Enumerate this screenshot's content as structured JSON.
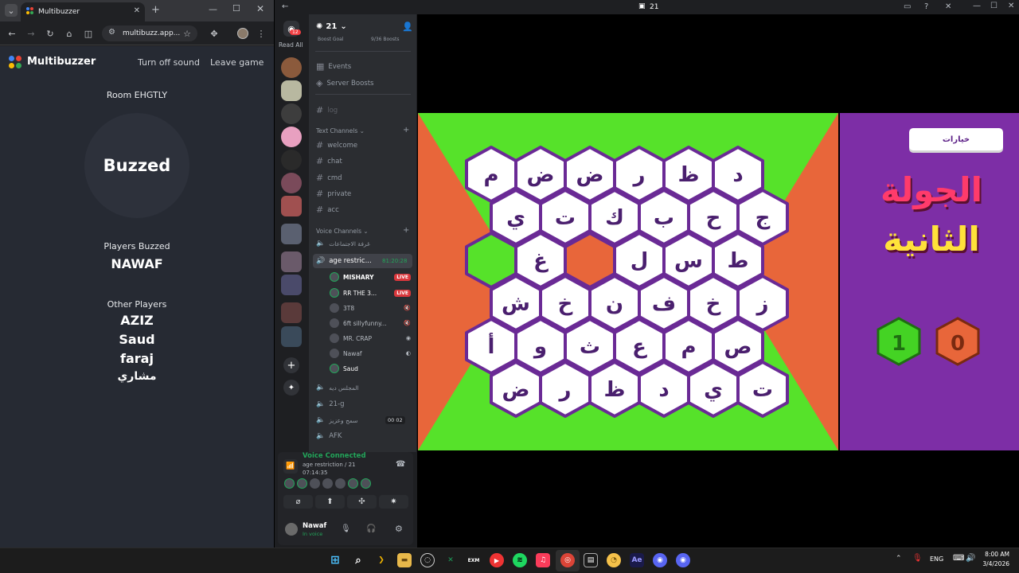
{
  "browser": {
    "tab_title": "Multibuzzer",
    "url": "multibuzz.app...",
    "brand_color": "#4285f4"
  },
  "multibuzzer": {
    "app_name": "Multibuzzer",
    "turn_off_sound": "Turn off sound",
    "leave_game": "Leave game",
    "room": "Room EHGTLY",
    "buzz_label": "Buzzed",
    "players_buzzed_heading": "Players Buzzed",
    "buzzed_players": [
      "NAWAF"
    ],
    "other_players_heading": "Other Players",
    "other_players": [
      "AZIZ",
      "Saud",
      "faraj",
      "مشاري"
    ]
  },
  "discord": {
    "title": "21",
    "server_name": "21",
    "read_all": "Read All",
    "mention_badge": "12",
    "boost_goal": "Boost Goal",
    "boost_count": "9/36 Boosts",
    "top_items": [
      "Events",
      "Server Boosts"
    ],
    "log_channel": "log",
    "text_category": "Text Channels",
    "text_channels": [
      "welcome",
      "chat",
      "cmd",
      "private",
      "acc"
    ],
    "voice_category": "Voice Channels",
    "voice_channels_top": [
      "غرفة الاجتماعات"
    ],
    "active_voice": {
      "name": "age restric...",
      "timer": "81:20:28"
    },
    "voice_users": [
      {
        "name": "MISHARY",
        "live": "LIVE"
      },
      {
        "name": "RR THE 3...",
        "live": "LIVE"
      },
      {
        "name": "3T8",
        "live": ""
      },
      {
        "name": "6ft sillyfunny...",
        "live": ""
      },
      {
        "name": "MR. CRAP",
        "live": ""
      },
      {
        "name": "Nawaf",
        "live": ""
      },
      {
        "name": "Saud",
        "live": ""
      }
    ],
    "voice_channels_bottom": [
      {
        "name": "المجلس ديه",
        "tag": ""
      },
      {
        "name": "21-g",
        "tag": ""
      },
      {
        "name": "سمح وعزيز",
        "tag": "00 02"
      },
      {
        "name": "AFK",
        "tag": ""
      }
    ],
    "voice_connected": "Voice Connected",
    "voice_location": "age restriction / 21",
    "voice_time": "07:14:35",
    "user_name": "Nawaf",
    "user_status": "In voice"
  },
  "game": {
    "choices_button": "خيارات",
    "round_line1": "الجولة",
    "round_line2": "الثانية",
    "score_green": "1",
    "score_orange": "0",
    "colors": {
      "green": "#56e22a",
      "orange": "#e8663a",
      "purple": "#7d2ea6",
      "hex_border": "#6a2a95"
    },
    "cells": [
      "م",
      "ض",
      "ض",
      "ر",
      "ظ",
      "د",
      "ي",
      "ت",
      "ك",
      "ب",
      "ح",
      "ج",
      "",
      "غ",
      "",
      "ل",
      "س",
      "ط",
      "ش",
      "خ",
      "ن",
      "ف",
      "خ",
      "ز",
      "أ",
      "و",
      "ث",
      "ع",
      "م",
      "ص",
      "ض",
      "ر",
      "ظ",
      "د",
      "ي",
      "ت"
    ],
    "cell_states": [
      "w",
      "w",
      "w",
      "w",
      "w",
      "w",
      "w",
      "w",
      "w",
      "w",
      "w",
      "w",
      "g",
      "w",
      "o",
      "w",
      "w",
      "w",
      "w",
      "w",
      "w",
      "w",
      "w",
      "w",
      "w",
      "w",
      "w",
      "w",
      "w",
      "w",
      "w",
      "w",
      "w",
      "w",
      "w",
      "w"
    ]
  },
  "taskbar": {
    "lang": "ENG",
    "time": "8:00 AM",
    "date": "3/4/2026"
  }
}
